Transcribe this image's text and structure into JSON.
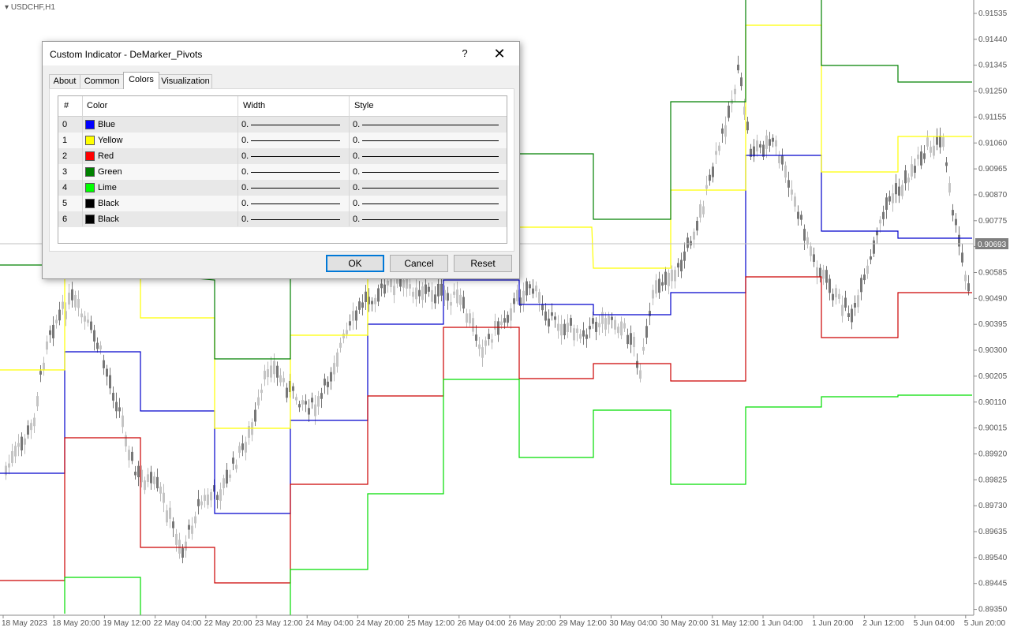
{
  "chart": {
    "symbol": "USDCHF,H1",
    "current_price": "0.90693",
    "price_ticks": [
      "0.91535",
      "0.91440",
      "0.91345",
      "0.91250",
      "0.91155",
      "0.91060",
      "0.90965",
      "0.90870",
      "0.90775",
      "0.90680",
      "0.90585",
      "0.90490",
      "0.90395",
      "0.90300",
      "0.90205",
      "0.90110",
      "0.90015",
      "0.89920",
      "0.89825",
      "0.89730",
      "0.89635",
      "0.89540",
      "0.89445",
      "0.89350"
    ],
    "time_ticks": [
      "18 May 2023",
      "18 May 20:00",
      "19 May 12:00",
      "22 May 04:00",
      "22 May 20:00",
      "23 May 12:00",
      "24 May 04:00",
      "24 May 20:00",
      "25 May 12:00",
      "26 May 04:00",
      "26 May 20:00",
      "29 May 12:00",
      "30 May 04:00",
      "30 May 20:00",
      "31 May 12:00",
      "1 Jun 04:00",
      "1 Jun 20:00",
      "2 Jun 12:00",
      "5 Jun 04:00",
      "5 Jun 20:00"
    ],
    "pivot_colors": {
      "blue": "#0000cc",
      "yellow": "#ffff00",
      "red": "#cc0000",
      "green": "#008000",
      "lime": "#00dd00"
    }
  },
  "dialog": {
    "title": "Custom Indicator - DeMarker_Pivots",
    "help_glyph": "?",
    "close_glyph": "✕",
    "tabs": [
      "About",
      "Common",
      "Colors",
      "Visualization"
    ],
    "active_tab": "Colors",
    "columns": [
      "#",
      "Color",
      "Width",
      "Style"
    ],
    "rows": [
      {
        "index": "0",
        "color_name": "Blue",
        "hex": "#0000ff",
        "width": "0.",
        "style": "0."
      },
      {
        "index": "1",
        "color_name": "Yellow",
        "hex": "#ffff00",
        "width": "0.",
        "style": "0."
      },
      {
        "index": "2",
        "color_name": "Red",
        "hex": "#ff0000",
        "width": "0.",
        "style": "0."
      },
      {
        "index": "3",
        "color_name": "Green",
        "hex": "#008000",
        "width": "0.",
        "style": "0."
      },
      {
        "index": "4",
        "color_name": "Lime",
        "hex": "#00ff00",
        "width": "0.",
        "style": "0."
      },
      {
        "index": "5",
        "color_name": "Black",
        "hex": "#000000",
        "width": "0.",
        "style": "0."
      },
      {
        "index": "6",
        "color_name": "Black",
        "hex": "#000000",
        "width": "0.",
        "style": "0."
      }
    ],
    "buttons": {
      "ok": "OK",
      "cancel": "Cancel",
      "reset": "Reset"
    }
  }
}
